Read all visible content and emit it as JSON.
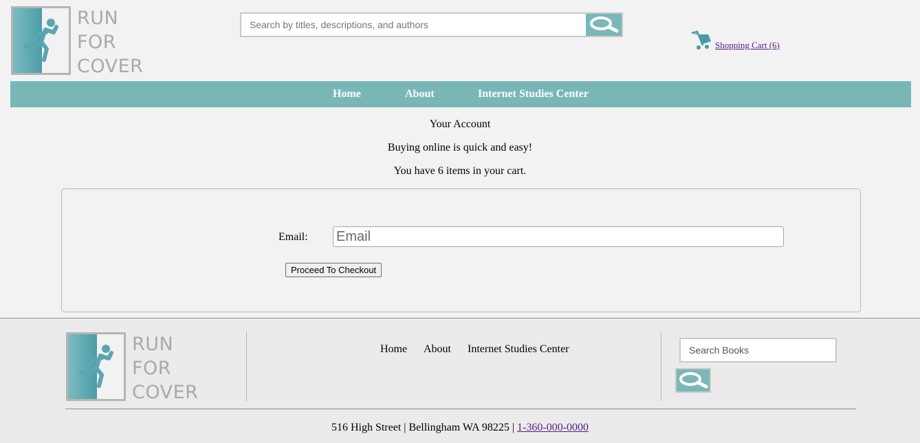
{
  "header": {
    "logo_lines": [
      "RUN",
      "FOR",
      "COVER"
    ],
    "search_placeholder": "Search by titles, descriptions, and authors",
    "cart_label": " Shopping Cart (6)"
  },
  "nav": {
    "items": [
      "Home",
      "About",
      "Internet Studies Center"
    ]
  },
  "main": {
    "title": "Your Account",
    "subtitle": "Buying online is quick and easy!",
    "cart_count_text": "You have 6 items in your cart.",
    "email_label": "Email:",
    "email_placeholder": "Email",
    "checkout_button": "Proceed To Checkout"
  },
  "footer": {
    "logo_lines": [
      "RUN",
      "FOR",
      "COVER"
    ],
    "links": [
      "Home",
      "About",
      "Internet Studies Center"
    ],
    "search_placeholder": "Search Books",
    "address": "516 High Street | Bellingham WA 98225 | ",
    "phone": "1-360-000-0000"
  },
  "colors": {
    "accent": "#79b7b7",
    "logo_gray": "#a9a9a9",
    "link": "#551a8b"
  }
}
